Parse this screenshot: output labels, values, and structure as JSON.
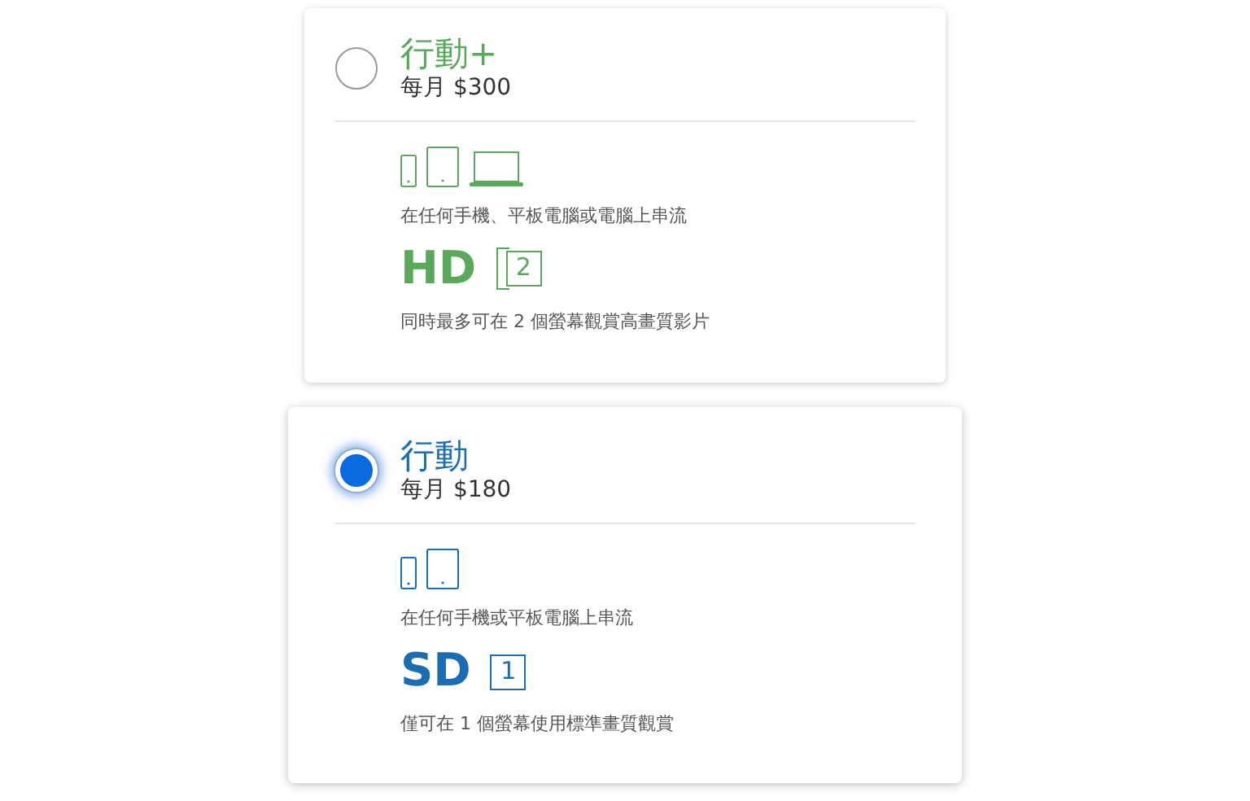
{
  "plans": [
    {
      "name": "行動+",
      "price": "每月 $300",
      "selected": false,
      "color": "#5aa95a",
      "devices": [
        {
          "kind": "phone"
        },
        {
          "kind": "tablet"
        },
        {
          "kind": "laptop"
        }
      ],
      "devices_text": "在任何手機、平板電腦或電腦上串流",
      "quality": "HD",
      "screens": "2",
      "stacked": true,
      "quality_text": "同時最多可在 2 個螢幕觀賞高畫質影片"
    },
    {
      "name": "行動",
      "price": "每月 $180",
      "selected": true,
      "color": "#1a6db3",
      "devices": [
        {
          "kind": "phone"
        },
        {
          "kind": "tablet"
        }
      ],
      "devices_text": "在任何手機或平板電腦上串流",
      "quality": "SD",
      "screens": "1",
      "stacked": false,
      "quality_text": "僅可在 1 個螢幕使用標準畫質觀賞"
    }
  ]
}
